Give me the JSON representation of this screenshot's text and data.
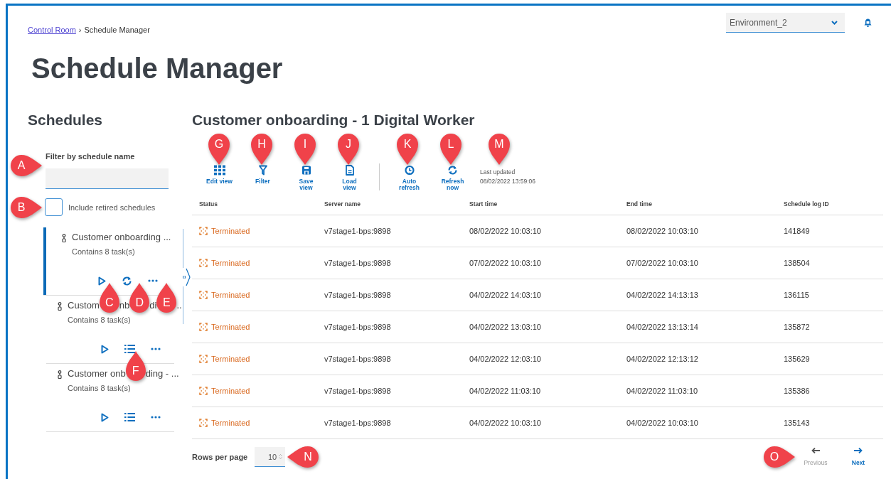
{
  "breadcrumb": {
    "link": "Control Room",
    "separator": "›",
    "current": "Schedule Manager"
  },
  "environment": {
    "value": "Environment_2"
  },
  "title": "Schedule Manager",
  "schedules": {
    "heading": "Schedules",
    "filter_label": "Filter by schedule name",
    "include_retired": {
      "label": "Include retired schedules",
      "checked": false
    },
    "items": [
      {
        "name_parts": [
          {
            "kind": "text",
            "text": "Customer onboarding ..."
          }
        ],
        "tasks": "Contains 8 task(s)",
        "selected": true,
        "actions": [
          {
            "kind": "play"
          },
          {
            "kind": "refresh"
          },
          {
            "kind": "more"
          }
        ]
      },
      {
        "name_parts": [
          {
            "kind": "text",
            "text": "Custom"
          },
          {
            "kind": "callout",
            "letter": "C"
          },
          {
            "kind": "text",
            "text": "nb"
          },
          {
            "kind": "callout",
            "letter": "D"
          },
          {
            "kind": "text",
            "text": "di"
          },
          {
            "kind": "callout",
            "letter": "E"
          },
          {
            "kind": "text",
            "text": ".."
          }
        ],
        "tasks": "Contains 8 task(s)",
        "selected": false,
        "actions": [
          {
            "kind": "play"
          },
          {
            "kind": "list"
          },
          {
            "kind": "more"
          }
        ]
      },
      {
        "name_parts": [
          {
            "kind": "text",
            "text": "Customer onb"
          },
          {
            "kind": "callout",
            "letter": "F"
          },
          {
            "kind": "text",
            "text": "ding - ..."
          }
        ],
        "tasks": "Contains 8 task(s)",
        "selected": false,
        "actions": [
          {
            "kind": "play"
          },
          {
            "kind": "list"
          },
          {
            "kind": "more"
          }
        ]
      }
    ]
  },
  "detail": {
    "title": "Customer onboarding - 1 Digital Worker",
    "toolbar": [
      {
        "kind": "edit",
        "label": "Edit view"
      },
      {
        "kind": "filter",
        "label": "Filter"
      },
      {
        "kind": "save",
        "label": "Save view"
      },
      {
        "kind": "load",
        "label": "Load view"
      },
      {
        "kind": "auto-refresh",
        "label": "Auto refresh"
      },
      {
        "kind": "refresh",
        "label": "Refresh now"
      }
    ],
    "last_updated": {
      "label": "Last updated",
      "value": "08/02/2022 13:59:06"
    },
    "table": {
      "columns": [
        "Status",
        "Server name",
        "Start time",
        "End time",
        "Schedule log ID"
      ],
      "rows": [
        {
          "status": {
            "kind": "terminated",
            "label": "Terminated"
          },
          "server": "v7stage1-bps:9898",
          "start": "08/02/2022 10:03:10",
          "end": "08/02/2022 10:03:10",
          "log_id": "141849"
        },
        {
          "status": {
            "kind": "terminated",
            "label": "Terminated"
          },
          "server": "v7stage1-bps:9898",
          "start": "07/02/2022 10:03:10",
          "end": "07/02/2022 10:03:10",
          "log_id": "138504"
        },
        {
          "status": {
            "kind": "terminated",
            "label": "Terminated"
          },
          "server": "v7stage1-bps:9898",
          "start": "04/02/2022 14:03:10",
          "end": "04/02/2022 14:13:13",
          "log_id": "136115"
        },
        {
          "status": {
            "kind": "terminated",
            "label": "Terminated"
          },
          "server": "v7stage1-bps:9898",
          "start": "04/02/2022 13:03:10",
          "end": "04/02/2022 13:13:14",
          "log_id": "135872"
        },
        {
          "status": {
            "kind": "terminated",
            "label": "Terminated"
          },
          "server": "v7stage1-bps:9898",
          "start": "04/02/2022 12:03:10",
          "end": "04/02/2022 12:13:12",
          "log_id": "135629"
        },
        {
          "status": {
            "kind": "terminated",
            "label": "Terminated"
          },
          "server": "v7stage1-bps:9898",
          "start": "04/02/2022 11:03:10",
          "end": "04/02/2022 11:03:10",
          "log_id": "135386"
        },
        {
          "status": {
            "kind": "terminated",
            "label": "Terminated"
          },
          "server": "v7stage1-bps:9898",
          "start": "04/02/2022 10:03:10",
          "end": "04/02/2022 10:03:10",
          "log_id": "135143"
        }
      ]
    },
    "pagination": {
      "rows_per_page_label": "Rows per page",
      "rows_per_page": "10",
      "previous": {
        "label": "Previous",
        "disabled": true
      },
      "next": {
        "label": "Next",
        "disabled": false
      }
    }
  },
  "callouts": [
    {
      "letter": "A"
    },
    {
      "letter": "B"
    },
    {
      "letter": "G"
    },
    {
      "letter": "H"
    },
    {
      "letter": "I"
    },
    {
      "letter": "J"
    },
    {
      "letter": "K"
    },
    {
      "letter": "L"
    },
    {
      "letter": "M"
    },
    {
      "letter": "N"
    },
    {
      "letter": "O"
    }
  ]
}
